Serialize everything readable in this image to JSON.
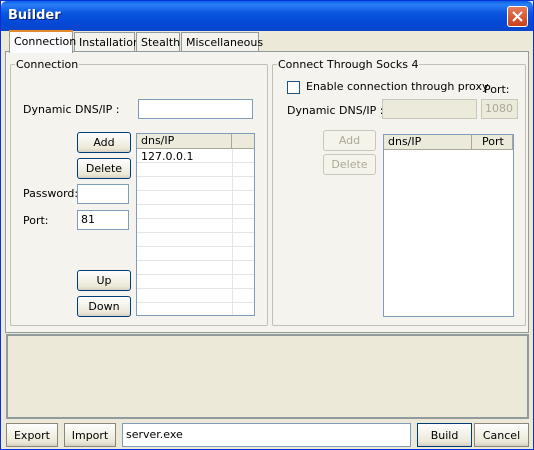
{
  "window": {
    "title": "Builder"
  },
  "tabs": [
    {
      "label": "Connection",
      "active": true
    },
    {
      "label": "Installation"
    },
    {
      "label": "Stealth"
    },
    {
      "label": "Miscellaneous"
    }
  ],
  "connection": {
    "group_title": "Connection",
    "dns_label": "Dynamic DNS/IP :",
    "dns_value": "",
    "add_label": "Add",
    "delete_label": "Delete",
    "password_label": "Password:",
    "password_value": "",
    "port_label": "Port:",
    "port_value": "81",
    "up_label": "Up",
    "down_label": "Down",
    "list_columns": [
      "dns/IP",
      ""
    ],
    "list_rows": [
      [
        "127.0.0.1",
        ""
      ]
    ]
  },
  "socks": {
    "group_title": "Connect Through Socks 4",
    "enable_label": "Enable connection through proxy",
    "enable_checked": false,
    "port_label": "Port:",
    "port_value": "1080",
    "dns_label": "Dynamic DNS/IP :",
    "dns_value": "",
    "add_label": "Add",
    "delete_label": "Delete",
    "list_columns": [
      "dns/IP",
      "Port"
    ]
  },
  "status": {
    "text": ""
  },
  "bottom": {
    "export_label": "Export",
    "import_label": "Import",
    "filename_value": "server.exe",
    "build_label": "Build",
    "cancel_label": "Cancel"
  },
  "icons": {
    "close": "close-icon",
    "checkbox": "checkbox-icon"
  },
  "colors": {
    "titlebar": "#0a57e0",
    "close_button": "#c7401c",
    "tab_highlight": "#e68b2c",
    "window_bg": "#ece9d8"
  }
}
